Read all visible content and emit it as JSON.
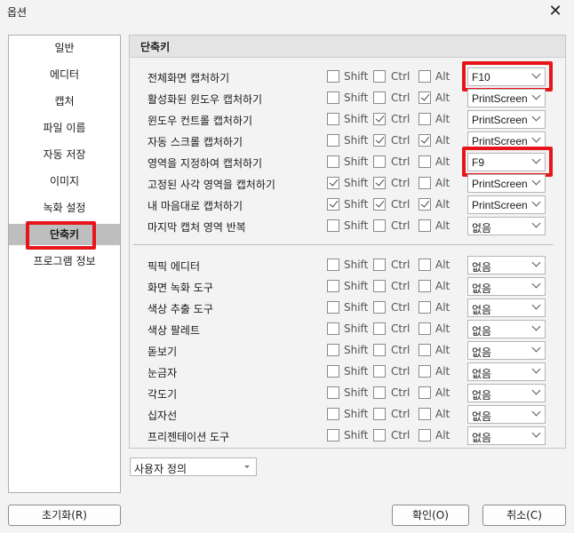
{
  "window": {
    "title": "옵션",
    "close_glyph": "✕"
  },
  "sidebar": {
    "items": [
      {
        "label": "일반"
      },
      {
        "label": "에디터"
      },
      {
        "label": "캡처"
      },
      {
        "label": "파일 이름"
      },
      {
        "label": "자동 저장"
      },
      {
        "label": "이미지"
      },
      {
        "label": "녹화 설정"
      },
      {
        "label": "단축키",
        "selected": true
      },
      {
        "label": "프로그램 정보"
      }
    ]
  },
  "panel": {
    "title": "단축키",
    "modifiers": {
      "shift": "Shift",
      "ctrl": "Ctrl",
      "alt": "Alt"
    },
    "rows": [
      {
        "label": "전체화면 캡처하기",
        "shift": false,
        "ctrl": false,
        "alt": false,
        "key": "F10",
        "highlighted": true
      },
      {
        "label": "활성화된 윈도우 캡처하기",
        "shift": false,
        "ctrl": false,
        "alt": true,
        "key": "PrintScreen"
      },
      {
        "label": "윈도우 컨트롤 캡처하기",
        "shift": false,
        "ctrl": true,
        "alt": false,
        "key": "PrintScreen"
      },
      {
        "label": "자동 스크롤 캡처하기",
        "shift": false,
        "ctrl": true,
        "alt": true,
        "key": "PrintScreen"
      },
      {
        "label": "영역을 지정하여 캡처하기",
        "shift": false,
        "ctrl": false,
        "alt": false,
        "key": "F9",
        "highlighted": true
      },
      {
        "label": "고정된 사각 영역을 캡처하기",
        "shift": true,
        "ctrl": true,
        "alt": false,
        "key": "PrintScreen"
      },
      {
        "label": "내 마음대로 캡처하기",
        "shift": true,
        "ctrl": true,
        "alt": true,
        "key": "PrintScreen"
      },
      {
        "label": "마지막 캡처 영역 반복",
        "shift": false,
        "ctrl": false,
        "alt": false,
        "key": "없음"
      },
      {
        "label": "픽픽 에디터",
        "shift": false,
        "ctrl": false,
        "alt": false,
        "key": "없음"
      },
      {
        "label": "화면 녹화 도구",
        "shift": false,
        "ctrl": false,
        "alt": false,
        "key": "없음"
      },
      {
        "label": "색상 추출 도구",
        "shift": false,
        "ctrl": false,
        "alt": false,
        "key": "없음"
      },
      {
        "label": "색상 팔레트",
        "shift": false,
        "ctrl": false,
        "alt": false,
        "key": "없음"
      },
      {
        "label": "돋보기",
        "shift": false,
        "ctrl": false,
        "alt": false,
        "key": "없음"
      },
      {
        "label": "눈금자",
        "shift": false,
        "ctrl": false,
        "alt": false,
        "key": "없음"
      },
      {
        "label": "각도기",
        "shift": false,
        "ctrl": false,
        "alt": false,
        "key": "없음"
      },
      {
        "label": "십자선",
        "shift": false,
        "ctrl": false,
        "alt": false,
        "key": "없음"
      },
      {
        "label": "프리젠테이션 도구",
        "shift": false,
        "ctrl": false,
        "alt": false,
        "key": "없음"
      }
    ]
  },
  "preset": {
    "value": "사용자 정의"
  },
  "buttons": {
    "reset": "초기화(R)",
    "ok": "확인(O)",
    "cancel": "취소(C)"
  },
  "colors": {
    "highlight": "#e8141b",
    "selected_bg": "#bebebe"
  }
}
